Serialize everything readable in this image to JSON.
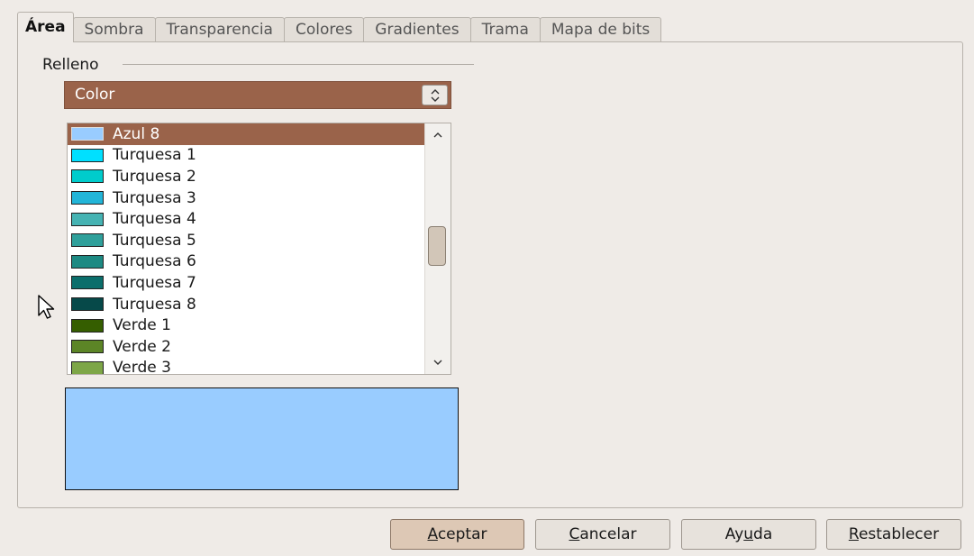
{
  "tabs": [
    {
      "label": "Área",
      "active": true
    },
    {
      "label": "Sombra"
    },
    {
      "label": "Transparencia"
    },
    {
      "label": "Colores"
    },
    {
      "label": "Gradientes"
    },
    {
      "label": "Trama"
    },
    {
      "label": "Mapa de bits"
    }
  ],
  "fill": {
    "group_label": "Relleno",
    "type_value": "Color",
    "colors": [
      {
        "name": "Azul 8",
        "color": "#99ccff",
        "selected": true
      },
      {
        "name": "Turquesa 1",
        "color": "#00e0ff"
      },
      {
        "name": "Turquesa 2",
        "color": "#00cccc"
      },
      {
        "name": "Turquesa 3",
        "color": "#22b5d8"
      },
      {
        "name": "Turquesa 4",
        "color": "#45b3b3"
      },
      {
        "name": "Turquesa 5",
        "color": "#2fa09b"
      },
      {
        "name": "Turquesa 6",
        "color": "#1d8a83"
      },
      {
        "name": "Turquesa 7",
        "color": "#0b6e6b"
      },
      {
        "name": "Turquesa 8",
        "color": "#064949"
      },
      {
        "name": "Verde 1",
        "color": "#355e00"
      },
      {
        "name": "Verde 2",
        "color": "#5c8526"
      },
      {
        "name": "Verde 3",
        "color": "#7da647"
      }
    ],
    "preview_color": "#99ccff"
  },
  "buttons": {
    "ok": {
      "mnemonic": "A",
      "rest": "ceptar"
    },
    "cancel": {
      "mnemonic": "C",
      "rest": "ancelar"
    },
    "help": {
      "before": "Ay",
      "mnemonic": "u",
      "after": "da"
    },
    "reset": {
      "mnemonic": "R",
      "rest": "establecer"
    }
  }
}
